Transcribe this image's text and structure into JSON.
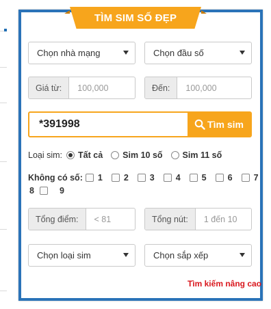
{
  "header": {
    "title": "TÌM SIM SỐ ĐẸP"
  },
  "filters": {
    "network_select": "Chọn nhà mạng",
    "prefix_select": "Chọn đầu số",
    "price_from_label": "Giá từ:",
    "price_from_value": "100,000",
    "price_to_label": "Đến:",
    "price_to_value": "100,000"
  },
  "search": {
    "query": "*391998",
    "button_label": "Tìm sim"
  },
  "sim_type": {
    "label": "Loại sim:",
    "options": [
      "Tất cả",
      "Sim 10 số",
      "Sim 11 số"
    ],
    "selected": "Tất cả"
  },
  "exclude_digits": {
    "label": "Không có số:",
    "digits": [
      "1",
      "2",
      "3",
      "4",
      "5",
      "6",
      "7",
      "8",
      "9"
    ]
  },
  "totals": {
    "sum_label": "Tổng điểm:",
    "sum_placeholder": "< 81",
    "nodes_label": "Tổng nút:",
    "nodes_placeholder": "1 đến 10"
  },
  "bottom": {
    "type_select": "Chọn loại sim",
    "sort_select": "Chọn sắp xếp",
    "advanced_link": "Tìm kiếm nâng cao"
  },
  "colors": {
    "accent": "#f7a51c",
    "border": "#2a73b8",
    "link": "#d9161c"
  },
  "icons": {
    "search_button_icon": "search-icon",
    "select_caret": "caret-down-icon"
  }
}
